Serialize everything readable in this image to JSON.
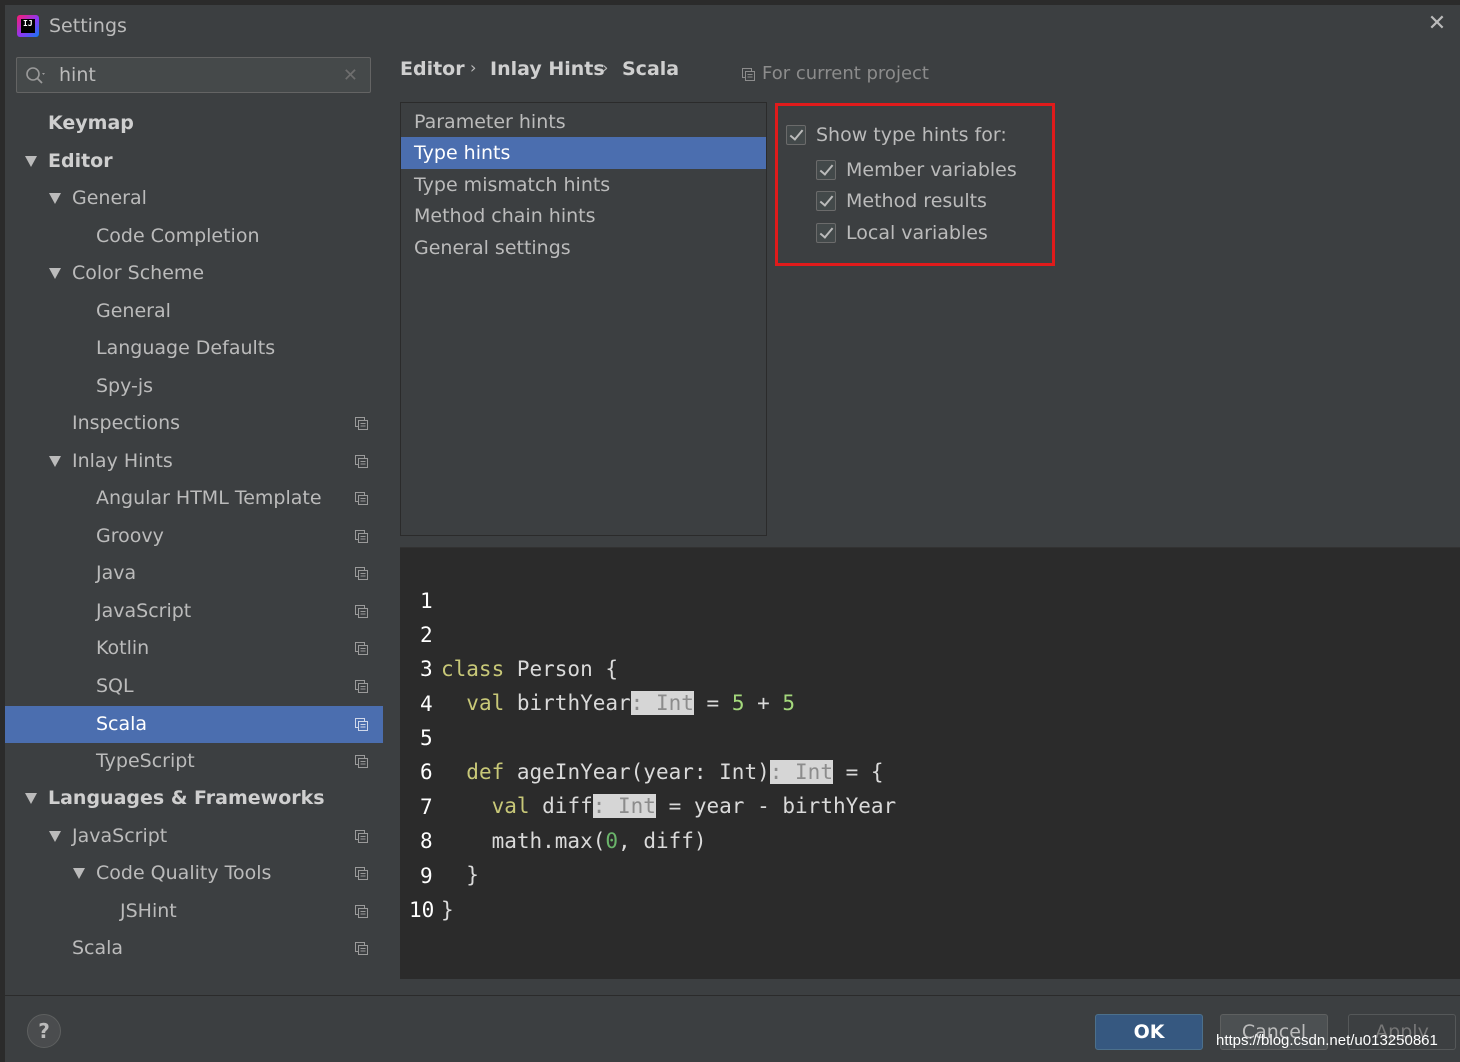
{
  "window": {
    "title": "Settings",
    "close_glyph": "✕"
  },
  "search": {
    "value": "hint",
    "clear_glyph": "✕"
  },
  "tree": [
    {
      "label": "Keymap",
      "bold": true
    },
    {
      "label": "Editor",
      "bold": true,
      "expanded": true
    },
    {
      "label": "General",
      "expanded": true
    },
    {
      "label": "Code Completion"
    },
    {
      "label": "Color Scheme",
      "expanded": true
    },
    {
      "label": "General"
    },
    {
      "label": "Language Defaults"
    },
    {
      "label": "Spy-js"
    },
    {
      "label": "Inspections",
      "project_icon": true
    },
    {
      "label": "Inlay Hints",
      "expanded": true,
      "project_icon": true
    },
    {
      "label": "Angular HTML Template",
      "project_icon": true
    },
    {
      "label": "Groovy",
      "project_icon": true
    },
    {
      "label": "Java",
      "project_icon": true
    },
    {
      "label": "JavaScript",
      "project_icon": true
    },
    {
      "label": "Kotlin",
      "project_icon": true
    },
    {
      "label": "SQL",
      "project_icon": true
    },
    {
      "label": "Scala",
      "project_icon": true,
      "selected": true
    },
    {
      "label": "TypeScript",
      "project_icon": true
    },
    {
      "label": "Languages & Frameworks",
      "bold": true,
      "expanded": true
    },
    {
      "label": "JavaScript",
      "expanded": true,
      "project_icon": true
    },
    {
      "label": "Code Quality Tools",
      "expanded": true,
      "project_icon": true
    },
    {
      "label": "JSHint",
      "project_icon": true
    },
    {
      "label": "Scala",
      "project_icon": true
    }
  ],
  "breadcrumb": {
    "items": [
      "Editor",
      "Inlay Hints",
      "Scala"
    ],
    "separator": "›",
    "for_project": "For current project"
  },
  "hint_categories": [
    {
      "label": "Parameter hints"
    },
    {
      "label": "Type hints",
      "selected": true
    },
    {
      "label": "Type mismatch hints"
    },
    {
      "label": "Method chain hints"
    },
    {
      "label": "General settings"
    }
  ],
  "options": {
    "show_type_hints": {
      "label": "Show type hints for:",
      "checked": true
    },
    "member_variables": {
      "label": "Member variables",
      "checked": true
    },
    "method_results": {
      "label": "Method results",
      "checked": true
    },
    "local_variables": {
      "label": "Local variables",
      "checked": true
    }
  },
  "editor": {
    "line_numbers": [
      "1",
      "2",
      "3",
      "4",
      "5",
      "6",
      "7",
      "8",
      "9",
      "10"
    ],
    "l2": {
      "kw": "class",
      "rest": " Person {"
    },
    "l3": {
      "indent": "  ",
      "kw": "val",
      "name": " birthYear",
      "hint": ": Int",
      "eq": " = ",
      "n1": "5",
      "op": " + ",
      "n2": "5"
    },
    "l5": {
      "indent": "  ",
      "kw": "def",
      "sig": " ageInYear(year: Int)",
      "hint": ": Int",
      "rest": " = {"
    },
    "l6": {
      "indent": "    ",
      "kw": "val",
      "name": " diff",
      "hint": ": Int",
      "rest": " = year - birthYear"
    },
    "l7": {
      "indent": "    ",
      "pre": "math.max(",
      "n": "0",
      "post": ", diff)"
    },
    "l8": {
      "text": "  }"
    },
    "l9": {
      "text": "}"
    }
  },
  "buttons": {
    "help": "?",
    "ok": "OK",
    "cancel": "Cancel",
    "apply": "Apply"
  },
  "watermark": "https://blog.csdn.net/u013250861",
  "colors": {
    "accent": "#4b6eaf",
    "highlight_box": "#e01b1b",
    "ok_button": "#365880"
  }
}
